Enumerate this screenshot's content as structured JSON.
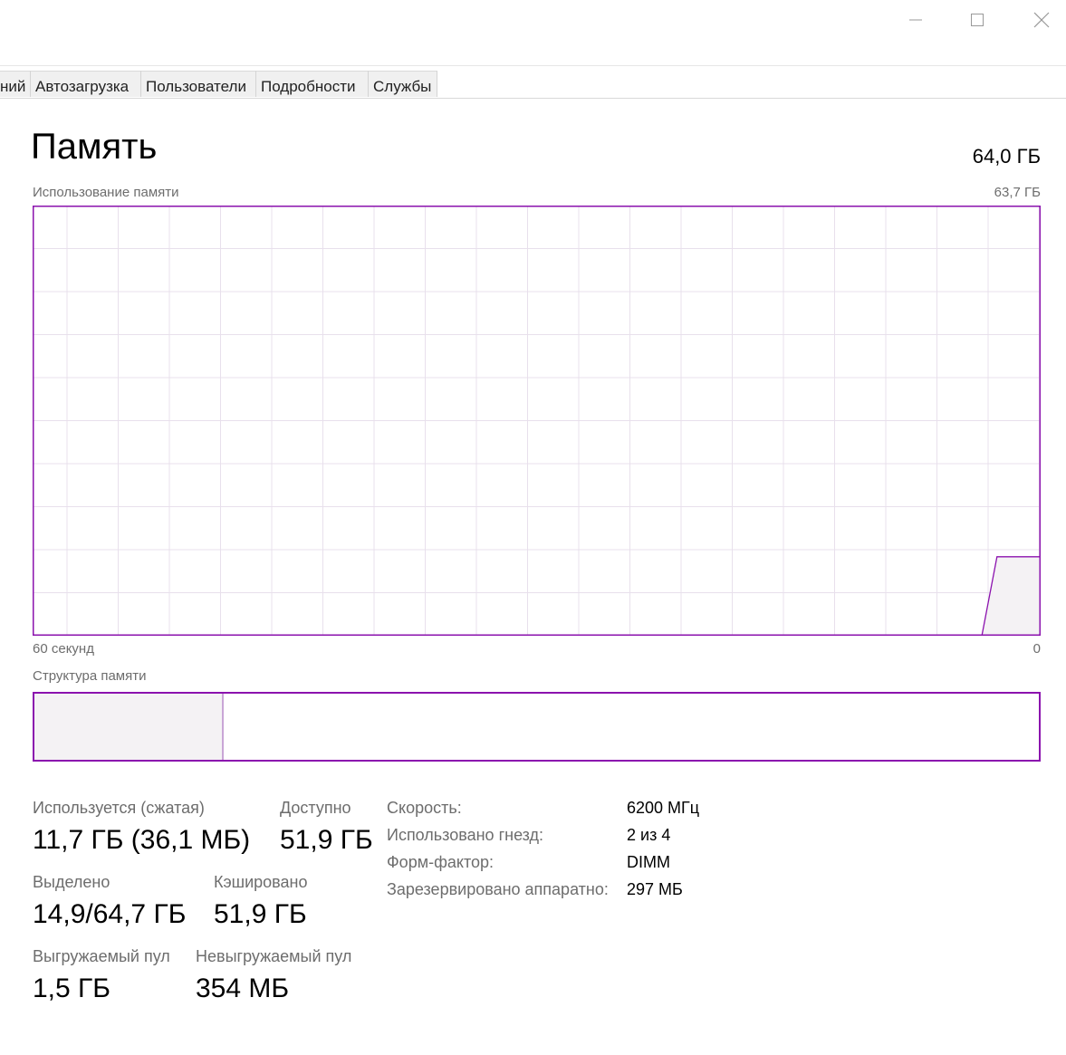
{
  "window": {
    "controls": [
      "minimize",
      "maximize",
      "close"
    ]
  },
  "tabs": [
    {
      "label": "ний"
    },
    {
      "label": "Автозагрузка"
    },
    {
      "label": "Пользователи"
    },
    {
      "label": "Подробности"
    },
    {
      "label": "Службы"
    }
  ],
  "header": {
    "title": "Память",
    "total": "64,0 ГБ"
  },
  "usage_chart": {
    "label": "Использование памяти",
    "max_label": "63,7 ГБ",
    "x_left_label": "60 секунд",
    "x_right_label": "0"
  },
  "structure": {
    "label": "Структура памяти",
    "used_fraction": 0.187
  },
  "stats": {
    "in_use": {
      "label": "Используется (сжатая)",
      "value": "11,7 ГБ (36,1 МБ)"
    },
    "available": {
      "label": "Доступно",
      "value": "51,9 ГБ"
    },
    "committed": {
      "label": "Выделено",
      "value": "14,9/64,7 ГБ"
    },
    "cached": {
      "label": "Кэшировано",
      "value": "51,9 ГБ"
    },
    "paged_pool": {
      "label": "Выгружаемый пул",
      "value": "1,5 ГБ"
    },
    "nonpaged_pool": {
      "label": "Невыгружаемый пул",
      "value": "354 МБ"
    }
  },
  "info": [
    {
      "label": "Скорость:",
      "value": "6200 МГц"
    },
    {
      "label": "Использовано гнезд:",
      "value": "2 из 4"
    },
    {
      "label": "Форм-фактор:",
      "value": "DIMM"
    },
    {
      "label": "Зарезервировано аппаратно:",
      "value": "297 МБ"
    }
  ],
  "colors": {
    "accent": "#8b12ae",
    "fill": "#f4f2f4",
    "grid": "#e8e0ec"
  },
  "chart_data": {
    "type": "area",
    "x_unit": "seconds ago",
    "x": [
      60,
      3.5,
      2.6,
      0
    ],
    "y": [
      0,
      0,
      11.7,
      11.7
    ],
    "ylim": [
      0,
      63.7
    ],
    "xlim": [
      60,
      0
    ],
    "grid": true
  }
}
